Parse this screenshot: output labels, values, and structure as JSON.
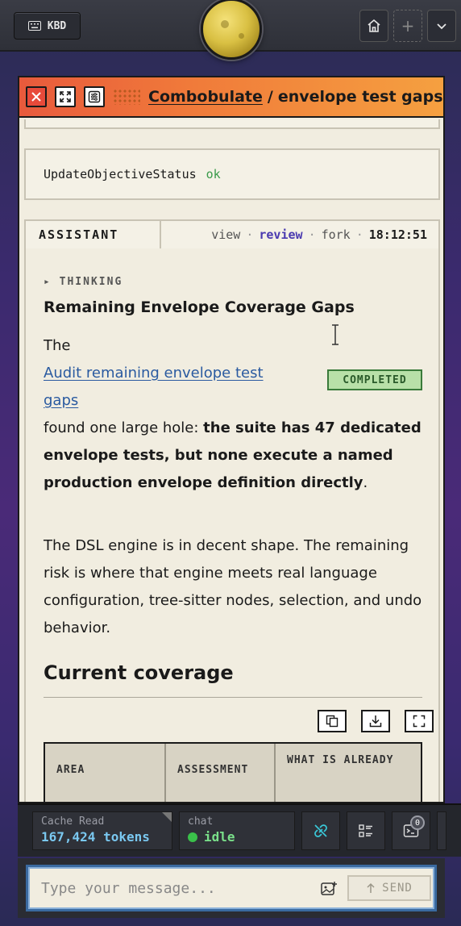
{
  "topbar": {
    "kbd_label": "KBD",
    "add_symbol": "+"
  },
  "panel": {
    "header": {
      "project_link": "Combobulate",
      "separator": "/",
      "session_title": "envelope test gaps"
    },
    "tool_result": {
      "name": "UpdateObjectiveStatus",
      "status": "ok"
    },
    "assistant_bar": {
      "label": "ASSISTANT",
      "actions": [
        "view",
        "review",
        "fork"
      ],
      "separator": "·",
      "time": "18:12:51"
    },
    "message": {
      "thinking_label": "▸ THINKING",
      "heading": "Remaining Envelope Coverage Gaps",
      "p1_prefix": "The",
      "p1_link": "Audit remaining envelope test gaps",
      "badge": "COMPLETED",
      "p1_mid": "found one large hole: ",
      "p1_bold": "the suite has 47 dedicated envelope tests, but none execute a named production envelope definition directly",
      "p1_end": ".",
      "p2": "The DSL engine is in decent shape. The remaining risk is where that engine meets real language configuration, tree-sitter nodes, selection, and undo behavior.",
      "section_heading": "Current coverage",
      "table_headers": [
        "AREA",
        "ASSESSMENT",
        "WHAT IS ALREADY"
      ]
    }
  },
  "statusbar": {
    "cache_label": "Cache Read",
    "cache_value": "167,424 tokens",
    "chat_label": "chat",
    "chat_value": "idle",
    "notif_count": "0"
  },
  "composer": {
    "placeholder": "Type your message...",
    "send_label": "SEND"
  },
  "colors": {
    "header_accent": "#f07a3a",
    "completed_badge": "#b8e0a8",
    "link": "#2a5aa0",
    "review_action": "#4a3ab0",
    "cache_value": "#7ac8f0",
    "idle": "#7ae08a"
  }
}
